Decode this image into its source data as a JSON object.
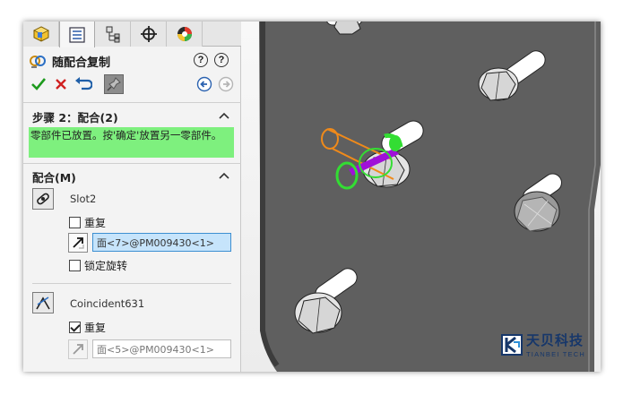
{
  "tabs": [
    {
      "icon": "feature-manager-icon"
    },
    {
      "icon": "property-manager-icon"
    },
    {
      "icon": "configuration-manager-icon"
    },
    {
      "icon": "dimxpert-manager-icon"
    },
    {
      "icon": "display-manager-icon"
    }
  ],
  "panel": {
    "title": "随配合复制",
    "help_labels": [
      "?",
      "?"
    ],
    "actions": {
      "ok": "check-icon",
      "cancel": "close-icon",
      "undo": "undo-icon",
      "pin": "pushpin-icon",
      "back": "back-arrow-icon",
      "forward": "forward-arrow-icon"
    }
  },
  "step": {
    "header": "步骤 2：配合(2)",
    "message": "零部件已放置。按'确定'放置另一零部件。"
  },
  "mates": {
    "header": "配合(M)",
    "items": [
      {
        "name": "Slot2",
        "repeat_label": "重复",
        "repeat_checked": false,
        "reference": "面<7>@PM009430<1>",
        "lock_label": "锁定旋转",
        "lock_checked": false
      },
      {
        "name": "Coincident631",
        "repeat_label": "重复",
        "repeat_checked": true,
        "reference": "面<5>@PM009430<1>"
      }
    ]
  },
  "brand": {
    "name_cn": "天贝科技",
    "name_en": "TIANBEI TECH",
    "color": "#17376a"
  },
  "colors": {
    "message_bg": "#7ef07e",
    "active_field": "#c6e4fb",
    "part_gray": "#5e5e5e",
    "preview_orange": "#f08a1a",
    "preview_green": "#33dd33",
    "preview_purple": "#a010d8"
  }
}
